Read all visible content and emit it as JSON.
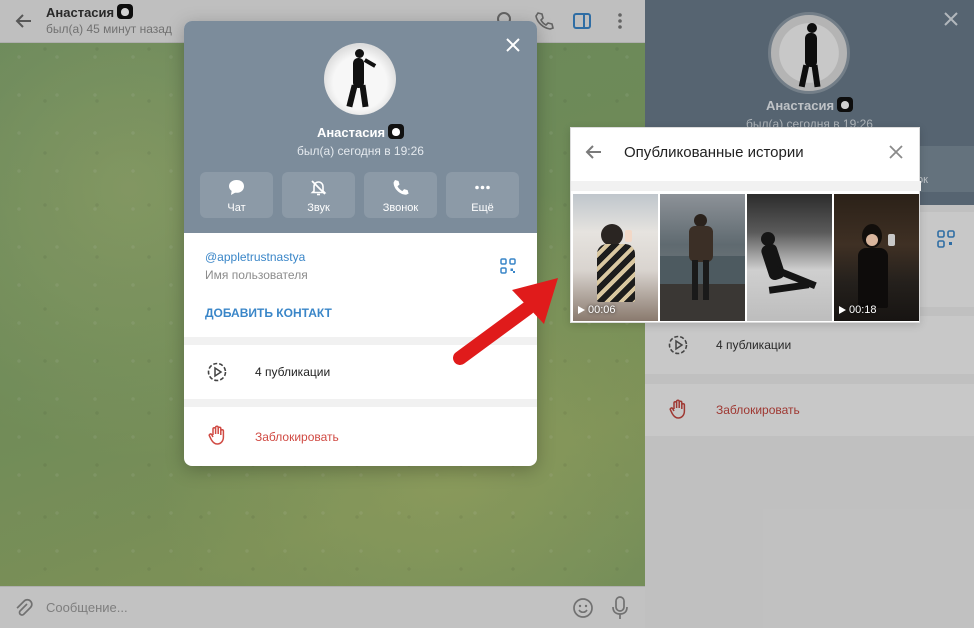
{
  "chat_header": {
    "name": "Анастасия",
    "status": "был(а) 45 минут назад"
  },
  "composer": {
    "placeholder": "Сообщение..."
  },
  "profile_popup": {
    "name": "Анастасия",
    "status": "был(а) сегодня в 19:26",
    "actions": [
      {
        "label": "Чат",
        "icon": "chat-icon"
      },
      {
        "label": "Звук",
        "icon": "mute-bell-icon"
      },
      {
        "label": "Звонок",
        "icon": "phone-icon"
      },
      {
        "label": "Ещё",
        "icon": "more-icon"
      }
    ],
    "username": "@appletrustnastya",
    "username_label": "Имя пользователя",
    "add_contact": "ДОБАВИТЬ КОНТАКТ",
    "publications": "4 публикации",
    "block": "Заблокировать"
  },
  "right_panel": {
    "name": "Анастасия",
    "status": "был(а) сегодня в 19:26",
    "button_partial": "ок",
    "publications": "4 публикации",
    "block": "Заблокировать"
  },
  "stories_popup": {
    "title": "Опубликованные истории",
    "thumbnails": [
      {
        "duration": "00:06"
      },
      {
        "duration": ""
      },
      {
        "duration": ""
      },
      {
        "duration": "00:18"
      }
    ]
  },
  "colors": {
    "accent_blue": "#3a86c8",
    "danger_red": "#d04a43",
    "header_gray": "#7c8c9b",
    "arrow_red": "#e01b1b"
  }
}
